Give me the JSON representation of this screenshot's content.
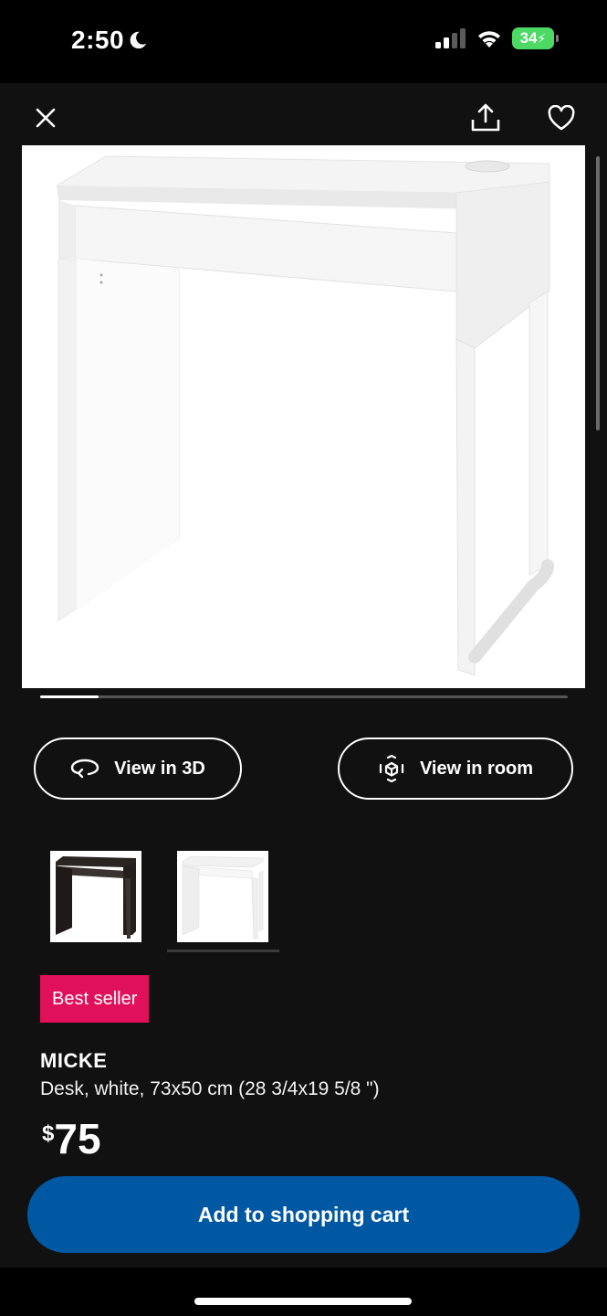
{
  "status_bar": {
    "time": "2:50",
    "battery": "34"
  },
  "product": {
    "badge": "Best seller",
    "name": "MICKE",
    "description": "Desk, white, 73x50 cm (28 3/4x19 5/8 \")",
    "price_currency": "$",
    "price_amount": "75",
    "gallery_progress": 0.11
  },
  "actions": {
    "view_3d": "View in 3D",
    "view_room": "View in room",
    "add_to_cart": "Add to shopping cart"
  },
  "variants": [
    {
      "color": "black-brown",
      "selected": false
    },
    {
      "color": "white",
      "selected": true
    }
  ],
  "icons": {
    "close": "close-icon",
    "share": "share-icon",
    "favorite": "heart-icon",
    "view_3d": "rotate-3d-icon",
    "view_room": "ar-cube-icon"
  },
  "colors": {
    "background": "#111111",
    "badge": "#e0105a",
    "primary_button": "#0058a3"
  }
}
